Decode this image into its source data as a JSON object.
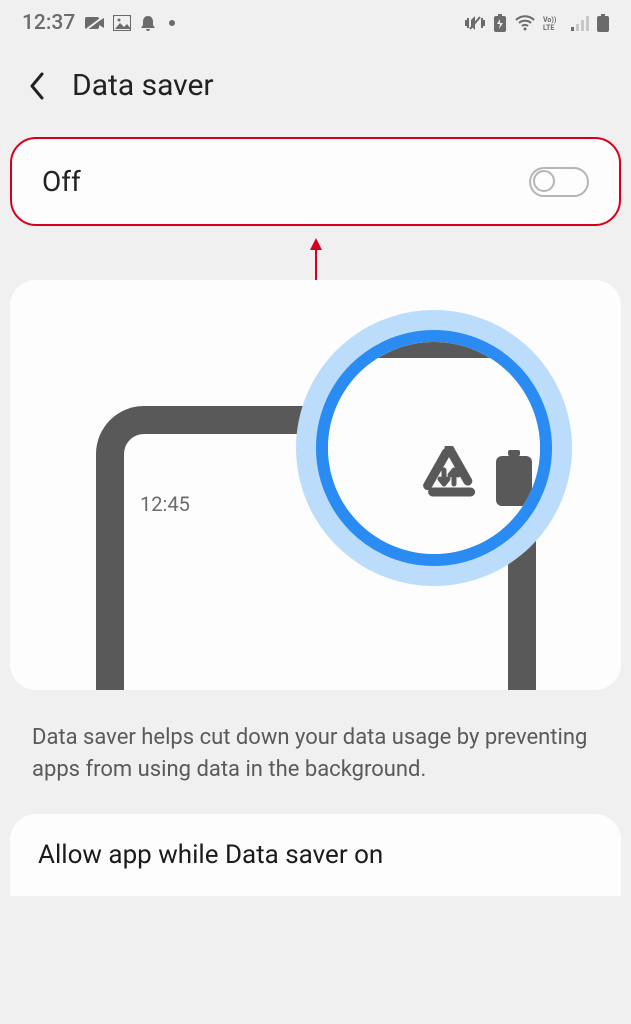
{
  "statusbar": {
    "clock": "12:37"
  },
  "appbar": {
    "title": "Data saver"
  },
  "toggle": {
    "state_label": "Off"
  },
  "illustration": {
    "phone_time": "12:45"
  },
  "description": "Data saver helps cut down your data usage by preventing apps from using data in the background.",
  "allow_row": {
    "label": "Allow app while Data saver on"
  }
}
